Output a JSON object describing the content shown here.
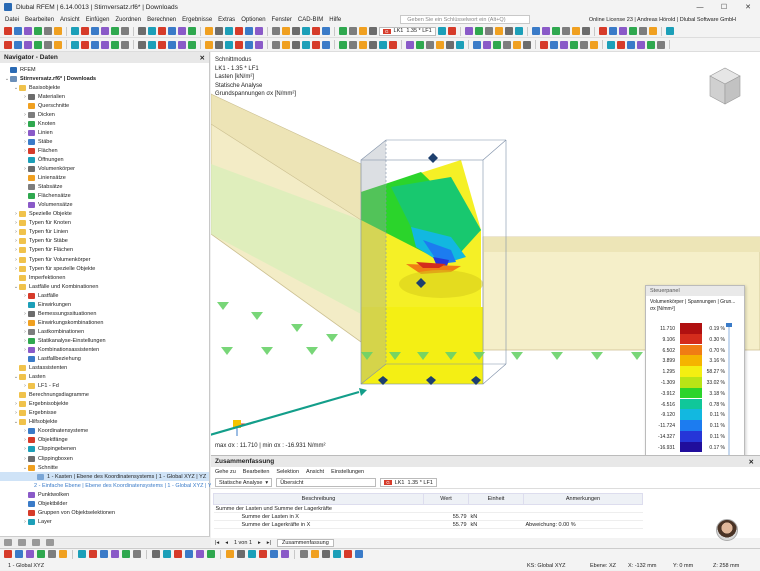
{
  "window": {
    "title": "Dlubal RFEM | 6.14.0013 | Stirnversatz.rf6* | Downloads",
    "controls": [
      "—",
      "☐",
      "✕"
    ]
  },
  "menu": {
    "items": [
      "Datei",
      "Bearbeiten",
      "Ansicht",
      "Einfügen",
      "Zuordnen",
      "Berechnen",
      "Ergebnisse",
      "Extras",
      "Optionen",
      "Fenster",
      "CAD-BIM",
      "Hilfe"
    ],
    "search_placeholder": "Geben Sie ein Schlüsselwort ein (Alt+Q)",
    "license": "Online License 23 | Andreas Hörold | Dlubal Software GmbH"
  },
  "toolbar": {
    "loadcase_tag": "G",
    "loadcase_id": "LK1",
    "loadcase_combo": "1.35 * LF1"
  },
  "navigator": {
    "title": "Navigator - Daten",
    "items": [
      {
        "label": "RFEM",
        "level": 0,
        "exp": "",
        "icon": "rfem"
      },
      {
        "label": "Stirnversatz.rf6* | Downloads",
        "level": 0,
        "exp": "⌄",
        "icon": "file",
        "bold": true
      },
      {
        "label": "Basisobjekte",
        "level": 1,
        "exp": "⌄",
        "icon": "folder"
      },
      {
        "label": "Materialien",
        "level": 2,
        "exp": "›",
        "icon": "material"
      },
      {
        "label": "Querschnitte",
        "level": 2,
        "exp": "",
        "icon": "section"
      },
      {
        "label": "Dicken",
        "level": 2,
        "exp": "›",
        "icon": "thickness"
      },
      {
        "label": "Knoten",
        "level": 2,
        "exp": "›",
        "icon": "node"
      },
      {
        "label": "Linien",
        "level": 2,
        "exp": "›",
        "icon": "line"
      },
      {
        "label": "Stäbe",
        "level": 2,
        "exp": "›",
        "icon": "member"
      },
      {
        "label": "Flächen",
        "level": 2,
        "exp": "›",
        "icon": "surface"
      },
      {
        "label": "Öffnungen",
        "level": 2,
        "exp": "",
        "icon": "opening"
      },
      {
        "label": "Volumenkörper",
        "level": 2,
        "exp": "›",
        "icon": "solid"
      },
      {
        "label": "Liniensätze",
        "level": 2,
        "exp": "",
        "icon": "lineset"
      },
      {
        "label": "Stabsätze",
        "level": 2,
        "exp": "",
        "icon": "memberset"
      },
      {
        "label": "Flächensätze",
        "level": 2,
        "exp": "",
        "icon": "surfaceset"
      },
      {
        "label": "Volumensätze",
        "level": 2,
        "exp": "",
        "icon": "solidset"
      },
      {
        "label": "Spezielle Objekte",
        "level": 1,
        "exp": "›",
        "icon": "folder"
      },
      {
        "label": "Typen für Knoten",
        "level": 1,
        "exp": "›",
        "icon": "folder"
      },
      {
        "label": "Typen für Linien",
        "level": 1,
        "exp": "›",
        "icon": "folder"
      },
      {
        "label": "Typen für Stäbe",
        "level": 1,
        "exp": "›",
        "icon": "folder"
      },
      {
        "label": "Typen für Flächen",
        "level": 1,
        "exp": "›",
        "icon": "folder"
      },
      {
        "label": "Typen für Volumenkörper",
        "level": 1,
        "exp": "›",
        "icon": "folder"
      },
      {
        "label": "Typen für spezielle Objekte",
        "level": 1,
        "exp": "›",
        "icon": "folder"
      },
      {
        "label": "Imperfektionen",
        "level": 1,
        "exp": "",
        "icon": "folder"
      },
      {
        "label": "Lastfälle und Kombinationen",
        "level": 1,
        "exp": "⌄",
        "icon": "folder"
      },
      {
        "label": "Lastfälle",
        "level": 2,
        "exp": "›",
        "icon": "loadcase"
      },
      {
        "label": "Einwirkungen",
        "level": 2,
        "exp": "",
        "icon": "action"
      },
      {
        "label": "Bemessungssituationen",
        "level": 2,
        "exp": "›",
        "icon": "designsit"
      },
      {
        "label": "Einwirkungskombinationen",
        "level": 2,
        "exp": "›",
        "icon": "actioncomb"
      },
      {
        "label": "Lastkombinationen",
        "level": 2,
        "exp": "›",
        "icon": "loadcomb"
      },
      {
        "label": "Statikanalyse-Einstellungen",
        "level": 2,
        "exp": "›",
        "icon": "analysis"
      },
      {
        "label": "Kombinationsassistenten",
        "level": 2,
        "exp": "›",
        "icon": "combowizard"
      },
      {
        "label": "Lastfallbeziehung",
        "level": 2,
        "exp": "",
        "icon": "relation"
      },
      {
        "label": "Lastassistenten",
        "level": 1,
        "exp": "",
        "icon": "folder"
      },
      {
        "label": "Lasten",
        "level": 1,
        "exp": "⌄",
        "icon": "folder"
      },
      {
        "label": "LF1 - Fd",
        "level": 2,
        "exp": "›",
        "icon": "folder"
      },
      {
        "label": "Berechnungsdiagramme",
        "level": 1,
        "exp": "",
        "icon": "folder"
      },
      {
        "label": "Ergebnisobjekte",
        "level": 1,
        "exp": "›",
        "icon": "folder"
      },
      {
        "label": "Ergebnisse",
        "level": 1,
        "exp": "›",
        "icon": "folder"
      },
      {
        "label": "Hilfsobjekte",
        "level": 1,
        "exp": "⌄",
        "icon": "folder"
      },
      {
        "label": "Koordinatensysteme",
        "level": 2,
        "exp": "›",
        "icon": "coord"
      },
      {
        "label": "Objektfänge",
        "level": 2,
        "exp": "›",
        "icon": "snap"
      },
      {
        "label": "Clippingebenen",
        "level": 2,
        "exp": "›",
        "icon": "clipplane"
      },
      {
        "label": "Clippingboxen",
        "level": 2,
        "exp": "›",
        "icon": "clipbox"
      },
      {
        "label": "Schnitte",
        "level": 2,
        "exp": "⌄",
        "icon": "section-cut"
      },
      {
        "label": "1 - Kasten | Ebene des Koordinatensystems | 1 - Global XYZ | YZ",
        "level": 3,
        "exp": "",
        "icon": "cut",
        "selected": true
      },
      {
        "label": "2 - Einfache Ebene | Ebene des Koordinatensystems | 1 - Global XYZ | YZ",
        "level": 3,
        "exp": "",
        "icon": "cut",
        "sub": true
      },
      {
        "label": "Punktwolken",
        "level": 2,
        "exp": "",
        "icon": "cloud"
      },
      {
        "label": "Objektbilder",
        "level": 2,
        "exp": "",
        "icon": "image"
      },
      {
        "label": "Gruppen von Objektselektionen",
        "level": 2,
        "exp": "",
        "icon": "group"
      },
      {
        "label": "Layer",
        "level": 2,
        "exp": "›",
        "icon": "layer"
      }
    ]
  },
  "viewport": {
    "info_lines": [
      "Schnittmodus",
      "LK1 - 1.35 * LF1",
      "Lasten [kN/m²]",
      "Statische Analyse",
      "Grundspannungen σx [N/mm²]"
    ],
    "max_min": "max σx : 11.710 | min σx : -16.931 N/mm²",
    "navcube_label": "-Y"
  },
  "control_panel": {
    "title": "Steuerpanel",
    "subtitle": "Volumenkörper | Spannungen | Grun...",
    "unit": "σx [N/mm²]",
    "legend": [
      {
        "value": "11.710",
        "color": "#b01010",
        "pct": "0.19 %"
      },
      {
        "value": "9.106",
        "color": "#d42c1c",
        "pct": "0.30 %"
      },
      {
        "value": "6.502",
        "color": "#f07d14",
        "pct": "0.70 %"
      },
      {
        "value": "3.899",
        "color": "#f5b400",
        "pct": "3.16 %"
      },
      {
        "value": "1.295",
        "color": "#f4ef12",
        "pct": "58.27 %"
      },
      {
        "value": "-1.309",
        "color": "#b9e416",
        "pct": "33.02 %"
      },
      {
        "value": "-3.912",
        "color": "#2bd42b",
        "pct": "3.18 %"
      },
      {
        "value": "-6.516",
        "color": "#10c79a",
        "pct": "0.78 %"
      },
      {
        "value": "-9.120",
        "color": "#12b8e0",
        "pct": "0.11 %"
      },
      {
        "value": "-11.724",
        "color": "#1c7cf0",
        "pct": "0.11 %"
      },
      {
        "value": "-14.327",
        "color": "#2636d8",
        "pct": "0.11 %"
      },
      {
        "value": "-16.931",
        "color": "#200e9c",
        "pct": "0.17 %"
      }
    ]
  },
  "summary": {
    "title": "Zusammenfassung",
    "menu": [
      "Gehe zu",
      "Bearbeiten",
      "Selektion",
      "Ansicht",
      "Einstellungen"
    ],
    "analysis": "Statische Analyse",
    "view": "Übersicht",
    "lc_tag": "G",
    "lc_id": "LK1",
    "lc_combo": "1.35 * LF1",
    "columns": [
      "Beschreibung",
      "Wert",
      "Einheit",
      "Anmerkungen"
    ],
    "group": "Summe der Lasten und Summe der Lagerkräfte",
    "rows": [
      {
        "desc": "Summe der Lasten in X",
        "val": "55.79",
        "unit": "kN",
        "note": ""
      },
      {
        "desc": "Summe der Lagerkräfte in X",
        "val": "55.79",
        "unit": "kN",
        "note": "Abweichung: 0.00 %"
      }
    ],
    "pager": "1 von 1",
    "tab": "Zusammenfassung"
  },
  "status": {
    "cs": "1 - Global XYZ",
    "sys": "KS: Global XYZ",
    "plane": "Ebene: XZ",
    "x": "X: -132 mm",
    "y": "Y: 0 mm",
    "z": "Z: 258 mm"
  }
}
